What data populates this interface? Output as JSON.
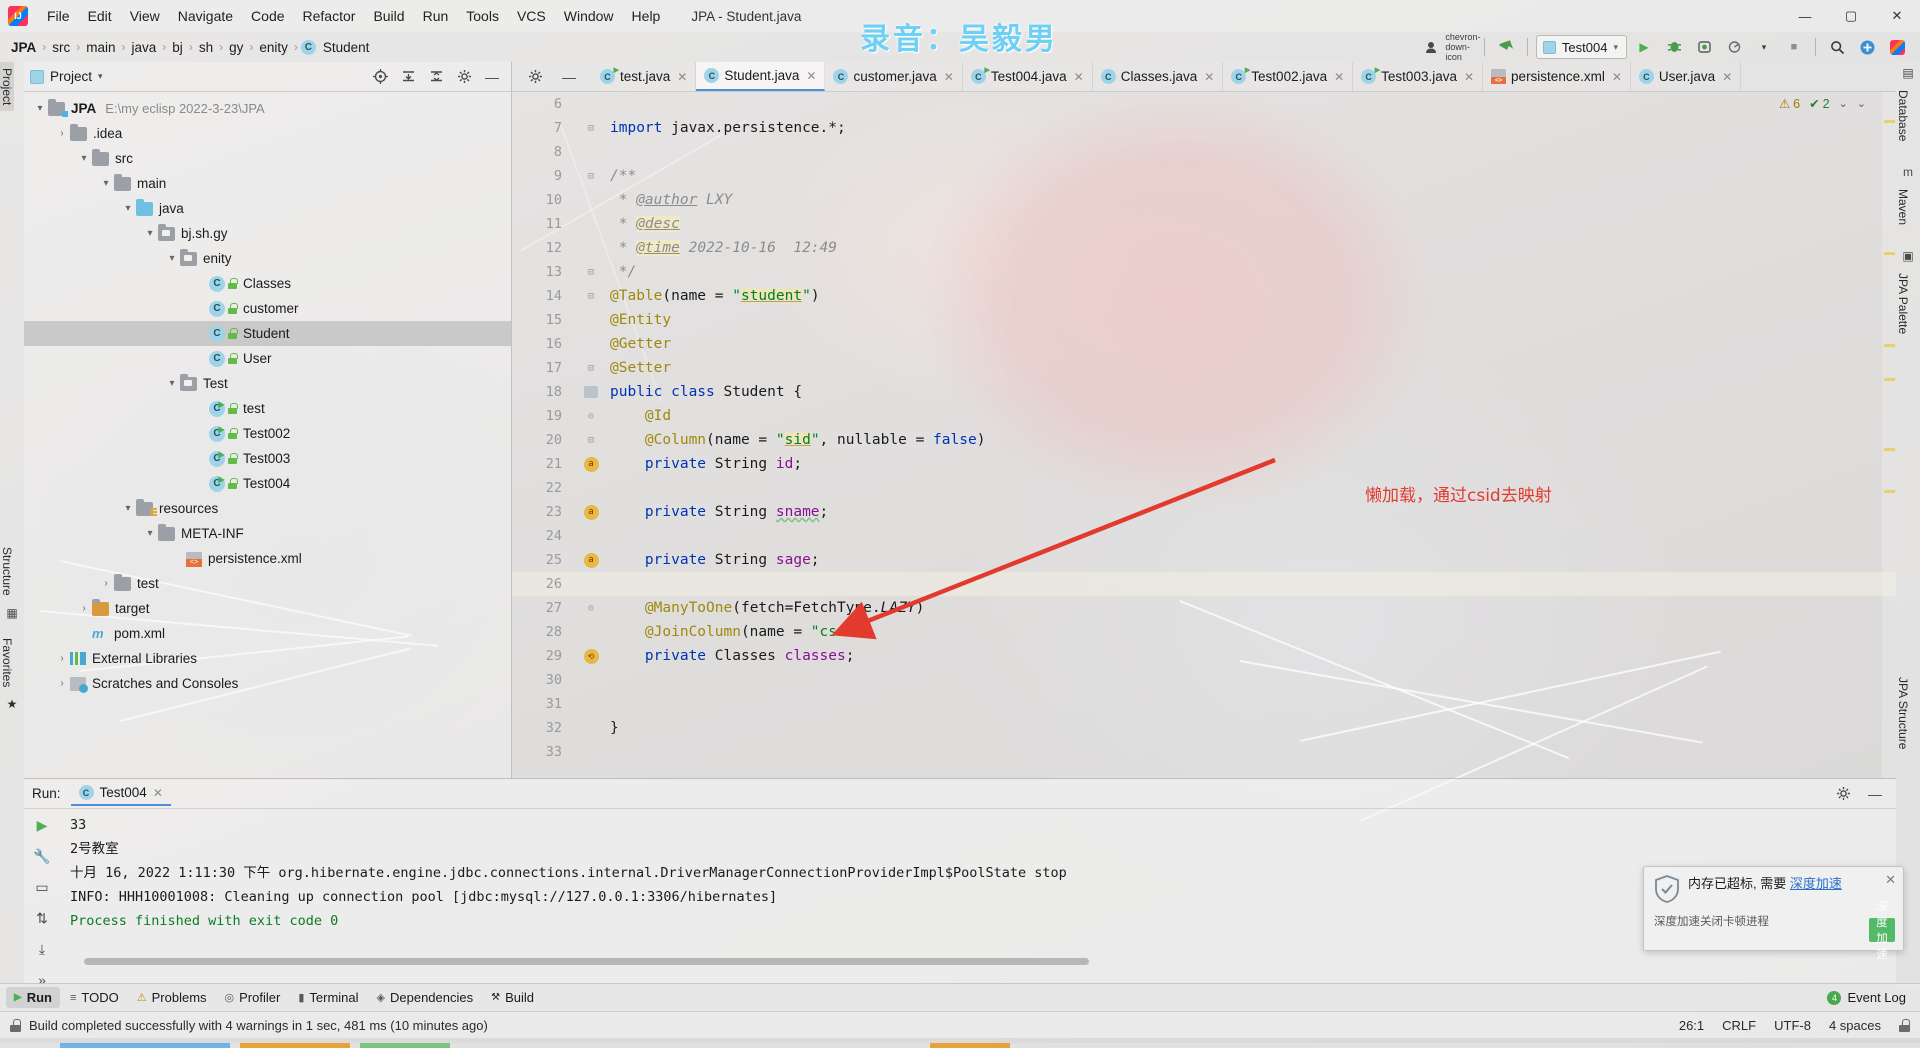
{
  "window": {
    "title": "JPA - Student.java",
    "watermark": "录音：吴毅男",
    "controls": {
      "minimize": "—",
      "maximize": "▢",
      "close": "✕"
    }
  },
  "menubar": {
    "items": [
      "File",
      "Edit",
      "View",
      "Navigate",
      "Code",
      "Refactor",
      "Build",
      "Run",
      "Tools",
      "VCS",
      "Window",
      "Help"
    ]
  },
  "breadcrumb": {
    "items": [
      "JPA",
      "src",
      "main",
      "java",
      "bj",
      "sh",
      "gy",
      "enity",
      "Student"
    ],
    "separator": "›",
    "class_badge": "C"
  },
  "nav_right": {
    "profile_icon": "user-icon",
    "dropdown_icon": "chevron-down-icon",
    "back_icon": "up-left-arrow-icon",
    "run_config": "Test004",
    "run_icon": "▶",
    "debug_icon": "debug-icon",
    "coverage_icon": "coverage-icon",
    "profiler_icon": "profiler-icon",
    "more_icon": "▾",
    "stop_icon": "■",
    "search_icon": "⌕",
    "updates_icon": "+",
    "ide_icon": "ide-icon"
  },
  "rails": {
    "left": [
      "Project",
      "Structure",
      "Favorites"
    ],
    "right": [
      "Database",
      "Maven",
      "JPA Palette",
      "JPA Structure"
    ]
  },
  "project_panel": {
    "title": "Project",
    "dropdown": "▾",
    "toolbar_icons": [
      "target-icon",
      "collapse-icon",
      "expand-icon",
      "gear-icon",
      "minimize-icon"
    ],
    "tree": [
      {
        "depth": 0,
        "arrow": "▾",
        "icon": "module-folder",
        "label": "JPA",
        "bold": true,
        "path": "E:\\my eclisp 2022-3-23\\JPA"
      },
      {
        "depth": 1,
        "arrow": "›",
        "icon": "folder",
        "label": ".idea"
      },
      {
        "depth": 1,
        "arrow": "▾",
        "icon": "folder",
        "label": "src"
      },
      {
        "depth": 2,
        "arrow": "▾",
        "icon": "folder",
        "label": "main"
      },
      {
        "depth": 3,
        "arrow": "▾",
        "icon": "source-folder",
        "label": "java"
      },
      {
        "depth": 4,
        "arrow": "▾",
        "icon": "package",
        "label": "bj.sh.gy"
      },
      {
        "depth": 5,
        "arrow": "▾",
        "icon": "package",
        "label": "enity"
      },
      {
        "depth": 6,
        "arrow": "",
        "icon": "class",
        "label": "Classes"
      },
      {
        "depth": 6,
        "arrow": "",
        "icon": "class",
        "label": "customer"
      },
      {
        "depth": 6,
        "arrow": "",
        "icon": "class",
        "label": "Student",
        "selected": true
      },
      {
        "depth": 6,
        "arrow": "",
        "icon": "class",
        "label": "User"
      },
      {
        "depth": 5,
        "arrow": "▾",
        "icon": "package",
        "label": "Test"
      },
      {
        "depth": 6,
        "arrow": "",
        "icon": "runnable-class",
        "label": "test"
      },
      {
        "depth": 6,
        "arrow": "",
        "icon": "runnable-class",
        "label": "Test002"
      },
      {
        "depth": 6,
        "arrow": "",
        "icon": "runnable-class",
        "label": "Test003"
      },
      {
        "depth": 6,
        "arrow": "",
        "icon": "runnable-class",
        "label": "Test004"
      },
      {
        "depth": 3,
        "arrow": "▾",
        "icon": "resource-folder",
        "label": "resources"
      },
      {
        "depth": 4,
        "arrow": "▾",
        "icon": "folder",
        "label": "META-INF"
      },
      {
        "depth": 5,
        "arrow": "",
        "icon": "xml",
        "label": "persistence.xml"
      },
      {
        "depth": 2,
        "arrow": "›",
        "icon": "folder",
        "label": "test"
      },
      {
        "depth": 1,
        "arrow": "›",
        "icon": "target-folder",
        "label": "target"
      },
      {
        "depth": 1,
        "arrow": "",
        "icon": "maven",
        "label": "pom.xml"
      },
      {
        "depth": 0,
        "arrow": "›",
        "icon": "libraries",
        "label": "External Libraries"
      },
      {
        "depth": 0,
        "arrow": "›",
        "icon": "scratches",
        "label": "Scratches and Consoles"
      }
    ]
  },
  "editor": {
    "lead_icons": [
      "gear-icon",
      "minimize-icon"
    ],
    "tabs": [
      {
        "label": "test.java",
        "icon": "runnable-class",
        "active": false
      },
      {
        "label": "Student.java",
        "icon": "class",
        "active": true
      },
      {
        "label": "customer.java",
        "icon": "class",
        "active": false
      },
      {
        "label": "Test004.java",
        "icon": "runnable-class",
        "active": false
      },
      {
        "label": "Classes.java",
        "icon": "class",
        "active": false
      },
      {
        "label": "Test002.java",
        "icon": "runnable-class",
        "active": false
      },
      {
        "label": "Test003.java",
        "icon": "runnable-class",
        "active": false
      },
      {
        "label": "persistence.xml",
        "icon": "xml",
        "active": false
      },
      {
        "label": "User.java",
        "icon": "class",
        "active": false
      }
    ],
    "close_glyph": "✕",
    "inspections": {
      "warning_count": "6",
      "warning_glyph": "⚠",
      "ok_count": "2",
      "ok_glyph": "✔",
      "caret_glyph": "⌄",
      "menu_glyph": "⌄"
    },
    "lines": [
      {
        "n": "6",
        "mark": "",
        "text": ""
      },
      {
        "n": "7",
        "mark": "fold",
        "text": "import javax.persistence.*;"
      },
      {
        "n": "8",
        "mark": "",
        "text": ""
      },
      {
        "n": "9",
        "mark": "fold",
        "text": "/**"
      },
      {
        "n": "10",
        "mark": "",
        "text": " * @author LXY"
      },
      {
        "n": "11",
        "mark": "",
        "text": " * @desc"
      },
      {
        "n": "12",
        "mark": "",
        "text": " * @time 2022-10-16  12:49"
      },
      {
        "n": "13",
        "mark": "fold",
        "text": " */"
      },
      {
        "n": "14",
        "mark": "fold",
        "text": "@Table(name = \"student\")"
      },
      {
        "n": "15",
        "mark": "",
        "text": "@Entity"
      },
      {
        "n": "16",
        "mark": "",
        "text": "@Getter"
      },
      {
        "n": "17",
        "mark": "fold",
        "text": "@Setter"
      },
      {
        "n": "18",
        "mark": "db",
        "text": "public class Student {"
      },
      {
        "n": "19",
        "mark": "fold",
        "text": "    @Id"
      },
      {
        "n": "20",
        "mark": "fold",
        "text": "    @Column(name = \"sid\", nullable = false)"
      },
      {
        "n": "21",
        "mark": "a-key",
        "text": "    private String id;"
      },
      {
        "n": "22",
        "mark": "",
        "text": ""
      },
      {
        "n": "23",
        "mark": "a",
        "text": "    private String sname;"
      },
      {
        "n": "24",
        "mark": "",
        "text": ""
      },
      {
        "n": "25",
        "mark": "a",
        "text": "    private String sage;"
      },
      {
        "n": "26",
        "mark": "",
        "text": "",
        "highlight": true
      },
      {
        "n": "27",
        "mark": "fold",
        "text": "    @ManyToOne(fetch=FetchType.LAZY)"
      },
      {
        "n": "28",
        "mark": "",
        "text": "    @JoinColumn(name = \"csid\")"
      },
      {
        "n": "29",
        "mark": "a-link",
        "text": "    private Classes classes;"
      },
      {
        "n": "30",
        "mark": "",
        "text": ""
      },
      {
        "n": "31",
        "mark": "",
        "text": ""
      },
      {
        "n": "32",
        "mark": "",
        "text": "}"
      },
      {
        "n": "33",
        "mark": "",
        "text": ""
      }
    ]
  },
  "annotation": {
    "text": "懒加载，通过csid去映射",
    "color": "#e23b2e"
  },
  "run_panel": {
    "label": "Run:",
    "tab": "Test004",
    "tab_close": "✕",
    "side_icons": [
      "run-icon",
      "wrench-icon",
      "camera-icon",
      "filter-icon",
      "download-icon",
      "more-icon"
    ],
    "header_icons": [
      "gear-icon",
      "minimize-icon"
    ],
    "console_lines": [
      {
        "text": "33",
        "style": "plain"
      },
      {
        "text": "2号教室",
        "style": "plain"
      },
      {
        "text": "十月 16, 2022 1:11:30 下午 org.hibernate.engine.jdbc.connections.internal.DriverManagerConnectionProviderImpl$PoolState stop",
        "style": "plain"
      },
      {
        "text": "INFO: HHH10001008: Cleaning up connection pool [jdbc:mysql://127.0.0.1:3306/hibernates]",
        "style": "plain"
      },
      {
        "text": "",
        "style": "plain"
      },
      {
        "text": "Process finished with exit code 0",
        "style": "ok"
      }
    ]
  },
  "bottom_bar": {
    "tools": [
      {
        "label": "Run",
        "icon": "▶",
        "selected": true
      },
      {
        "label": "TODO",
        "icon": "≡",
        "selected": false
      },
      {
        "label": "Problems",
        "icon": "⚠",
        "selected": false
      },
      {
        "label": "Profiler",
        "icon": "◎",
        "selected": false
      },
      {
        "label": "Terminal",
        "icon": "▮",
        "selected": false
      },
      {
        "label": "Dependencies",
        "icon": "◈",
        "selected": false
      },
      {
        "label": "Build",
        "icon": "🔨",
        "selected": false
      }
    ],
    "expand_icon": "»",
    "event_log": {
      "label": "Event Log",
      "badge": "4"
    }
  },
  "status_bar": {
    "message": "Build completed successfully with 4 warnings in 1 sec, 481 ms (10 minutes ago)",
    "caret": "26:1",
    "line_sep": "CRLF",
    "encoding": "UTF-8",
    "indent": "4 spaces",
    "lock_icon": "lock-icon"
  },
  "toast": {
    "icon": "shield-icon",
    "title_before": "内存已超标, 需要",
    "title_link": "深度加速",
    "subtitle": "深度加速关闭卡顿进程",
    "button": "深度加速",
    "close": "✕"
  },
  "colors": {
    "accent": "#4a90d9",
    "annotation_red": "#e23b2e",
    "success_green": "#0a7d22",
    "warning_yellow": "#9a7b00",
    "class_icon_blue": "#9fd4e8"
  }
}
